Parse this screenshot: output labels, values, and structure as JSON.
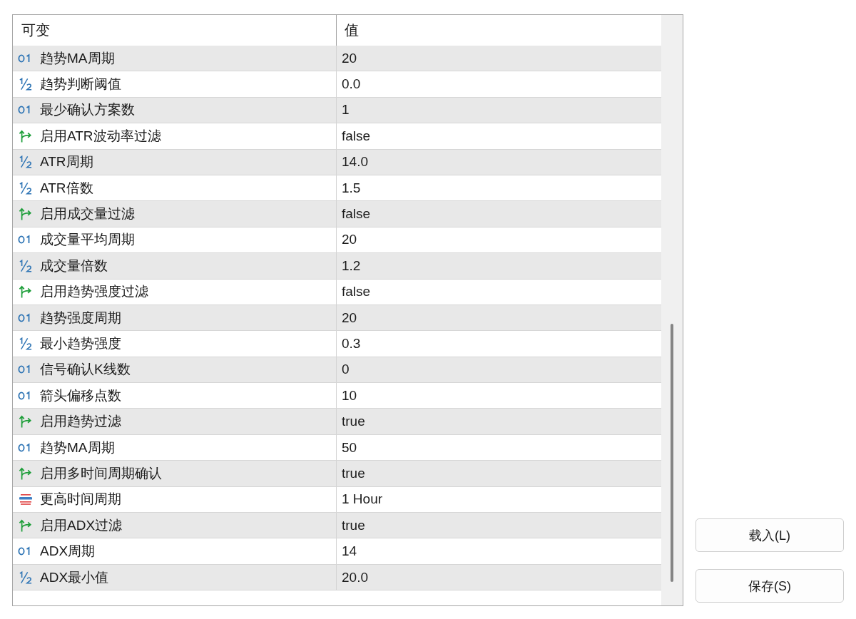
{
  "table": {
    "columns": [
      "可变",
      "值"
    ],
    "rows": [
      {
        "kind": "int",
        "name": "趋势MA周期",
        "value": "20"
      },
      {
        "kind": "double",
        "name": "趋势判断阈值",
        "value": "0.0"
      },
      {
        "kind": "int",
        "name": "最少确认方案数",
        "value": "1"
      },
      {
        "kind": "bool",
        "name": "启用ATR波动率过滤",
        "value": "false"
      },
      {
        "kind": "double",
        "name": "ATR周期",
        "value": "14.0"
      },
      {
        "kind": "double",
        "name": "ATR倍数",
        "value": "1.5"
      },
      {
        "kind": "bool",
        "name": "启用成交量过滤",
        "value": "false"
      },
      {
        "kind": "int",
        "name": "成交量平均周期",
        "value": "20"
      },
      {
        "kind": "double",
        "name": "成交量倍数",
        "value": "1.2"
      },
      {
        "kind": "bool",
        "name": "启用趋势强度过滤",
        "value": "false"
      },
      {
        "kind": "int",
        "name": "趋势强度周期",
        "value": "20"
      },
      {
        "kind": "double",
        "name": "最小趋势强度",
        "value": "0.3"
      },
      {
        "kind": "int",
        "name": "信号确认K线数",
        "value": "0"
      },
      {
        "kind": "int",
        "name": "箭头偏移点数",
        "value": "10"
      },
      {
        "kind": "bool",
        "name": "启用趋势过滤",
        "value": "true"
      },
      {
        "kind": "int",
        "name": "趋势MA周期",
        "value": "50"
      },
      {
        "kind": "bool",
        "name": "启用多时间周期确认",
        "value": "true"
      },
      {
        "kind": "enum",
        "name": "更高时间周期",
        "value": "1 Hour"
      },
      {
        "kind": "bool",
        "name": "启用ADX过滤",
        "value": "true"
      },
      {
        "kind": "int",
        "name": "ADX周期",
        "value": "14"
      },
      {
        "kind": "double",
        "name": "ADX最小值",
        "value": "20.0"
      }
    ]
  },
  "buttons": [
    "载入(L)",
    "保存(S)"
  ]
}
